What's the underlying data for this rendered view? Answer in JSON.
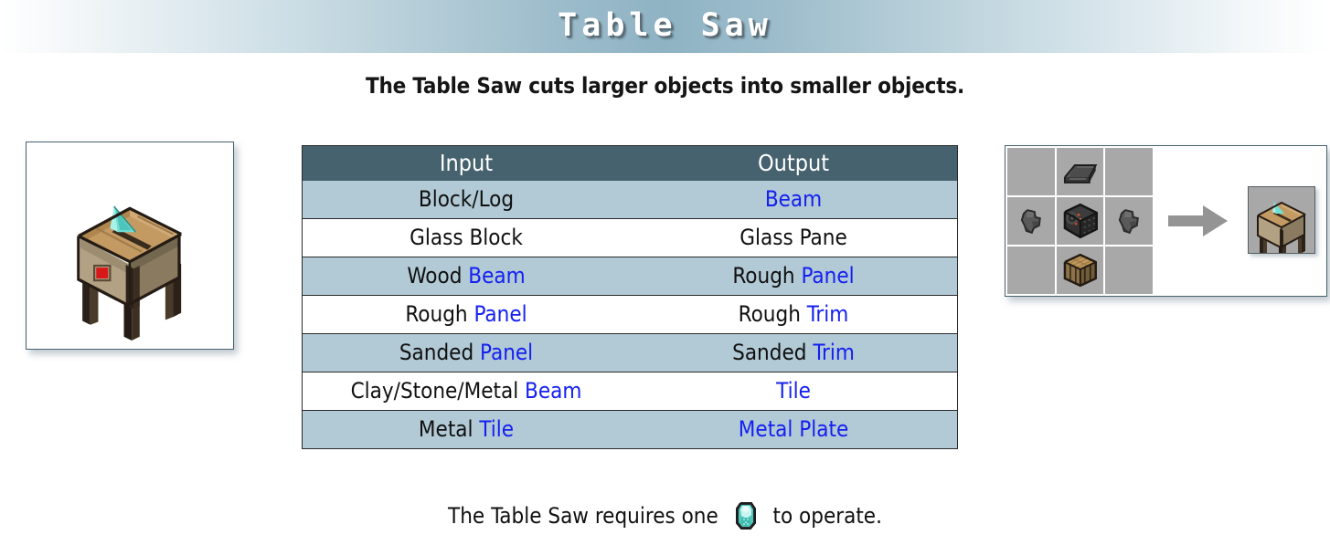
{
  "banner": {
    "title": "Table Saw",
    "gradient_edge": "#ffffff",
    "gradient_center": "#8fb3c4"
  },
  "subtitle": "The Table Saw cuts larger objects into smaller objects.",
  "preview": {
    "alt": "Table Saw block render",
    "border_color": "#46626e"
  },
  "table": {
    "header_bg": "#46626e",
    "shade_bg": "#b2cad6",
    "link_color": "#1420f0",
    "columns": [
      "Input",
      "Output"
    ],
    "rows": [
      {
        "shaded": true,
        "input_plain": "Block/Log",
        "input_link": "",
        "output_plain": "",
        "output_link": "Beam"
      },
      {
        "shaded": false,
        "input_plain": "Glass Block",
        "input_link": "",
        "output_plain": "Glass Pane",
        "output_link": ""
      },
      {
        "shaded": true,
        "input_plain": "Wood ",
        "input_link": "Beam",
        "output_plain": "Rough ",
        "output_link": "Panel"
      },
      {
        "shaded": false,
        "input_plain": "Rough ",
        "input_link": "Panel",
        "output_plain": "Rough ",
        "output_link": "Trim"
      },
      {
        "shaded": true,
        "input_plain": "Sanded ",
        "input_link": "Panel",
        "output_plain": "Sanded ",
        "output_link": "Trim"
      },
      {
        "shaded": false,
        "input_plain": "Clay/Stone/Metal ",
        "input_link": "Beam",
        "output_plain": "",
        "output_link": "Tile"
      },
      {
        "shaded": true,
        "input_plain": "Metal ",
        "input_link": "Tile",
        "output_plain": "",
        "output_link": "Metal Plate"
      }
    ]
  },
  "crafting": {
    "slot_bg": "#a8a8a8",
    "arrow_color": "#949494",
    "grid": [
      {
        "position": "top-left",
        "item": ""
      },
      {
        "position": "top-center",
        "item": "iron-ingot"
      },
      {
        "position": "top-right",
        "item": ""
      },
      {
        "position": "middle-left",
        "item": "flint"
      },
      {
        "position": "middle-center",
        "item": "machine-frame"
      },
      {
        "position": "middle-right",
        "item": "flint"
      },
      {
        "position": "bottom-left",
        "item": ""
      },
      {
        "position": "bottom-center",
        "item": "crafting-table"
      },
      {
        "position": "bottom-right",
        "item": ""
      }
    ],
    "arrow_icon": "arrow-right-icon",
    "result": "table-saw"
  },
  "footer": {
    "text_before": "The Table Saw requires one",
    "icon": "diamond-icon",
    "text_after": "to operate."
  }
}
